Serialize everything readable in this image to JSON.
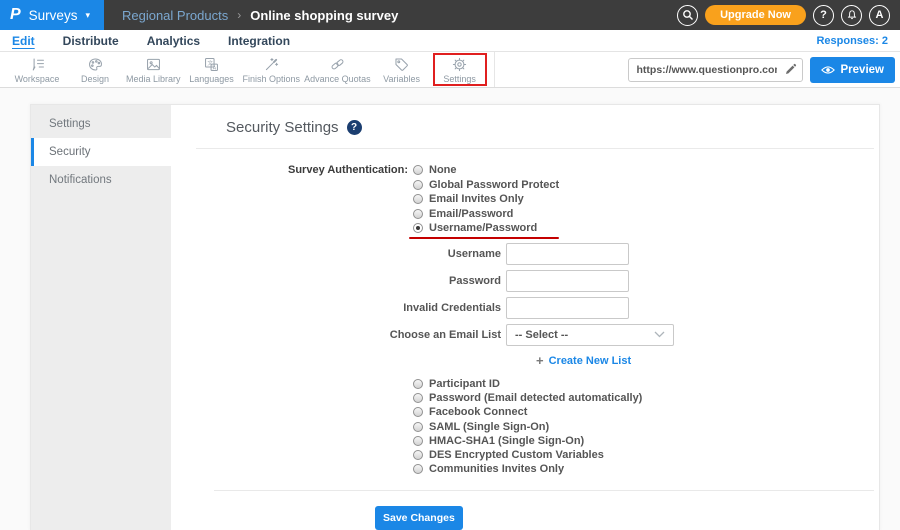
{
  "header": {
    "logo": "P",
    "product": "Surveys",
    "caret": "▾",
    "breadcrumb": {
      "parent": "Regional Products",
      "separator": "›",
      "current": "Online shopping survey"
    },
    "upgrade_label": "Upgrade Now",
    "help_label": "?",
    "avatar_label": "A",
    "icons": [
      "search-icon",
      "bell-icon"
    ]
  },
  "nav": {
    "tabs": [
      {
        "label": "Edit",
        "active": true
      },
      {
        "label": "Distribute",
        "active": false
      },
      {
        "label": "Analytics",
        "active": false
      },
      {
        "label": "Integration",
        "active": false
      }
    ],
    "responses_label": "Responses: 2"
  },
  "toolbar": {
    "items": [
      {
        "label": "Workspace",
        "icon": "pencil-list-icon"
      },
      {
        "label": "Design",
        "icon": "palette-icon"
      },
      {
        "label": "Media Library",
        "icon": "image-icon"
      },
      {
        "label": "Languages",
        "icon": "translate-icon"
      },
      {
        "label": "Finish Options",
        "icon": "magic-wand-icon"
      },
      {
        "label": "Advance Quotas",
        "icon": "chain-link-icon"
      },
      {
        "label": "Variables",
        "icon": "tag-icon"
      },
      {
        "label": "Settings",
        "icon": "gear-icon",
        "annotated": true
      }
    ],
    "url_value": "https://www.questionpro.com/t/APNrFZ",
    "preview_label": "Preview"
  },
  "sidebar": {
    "items": [
      {
        "label": "Settings",
        "active": false
      },
      {
        "label": "Security",
        "active": true
      },
      {
        "label": "Notifications",
        "active": false
      }
    ]
  },
  "main": {
    "title": "Security Settings",
    "help_label": "?",
    "auth_label": "Survey Authentication:",
    "auth_top": [
      {
        "label": "None",
        "selected": false
      },
      {
        "label": "Global Password Protect",
        "selected": false
      },
      {
        "label": "Email Invites Only",
        "selected": false
      },
      {
        "label": "Email/Password",
        "selected": false
      },
      {
        "label": "Username/Password",
        "selected": true,
        "annotated": true
      }
    ],
    "fields": [
      {
        "label": "Username",
        "value": ""
      },
      {
        "label": "Password",
        "value": ""
      },
      {
        "label": "Invalid Credentials",
        "value": ""
      }
    ],
    "email_list": {
      "label": "Choose an Email List",
      "value": "-- Select --"
    },
    "create_list": {
      "plus": "+",
      "label": "Create New List"
    },
    "auth_bottom": [
      {
        "label": "Participant ID"
      },
      {
        "label": "Password (Email detected automatically)"
      },
      {
        "label": "Facebook Connect"
      },
      {
        "label": "SAML (Single Sign-On)"
      },
      {
        "label": "HMAC-SHA1 (Single Sign-On)"
      },
      {
        "label": "DES Encrypted Custom Variables"
      },
      {
        "label": "Communities Invites Only"
      }
    ],
    "save_label": "Save Changes"
  },
  "colors": {
    "accent_blue": "#1b87e6",
    "header_dark": "#3d3d3d",
    "upgrade_orange": "#f9a11c",
    "annotation_red": "#e01f1f",
    "help_badge_navy": "#1b3e70",
    "sidebar_grey": "#ededed"
  }
}
